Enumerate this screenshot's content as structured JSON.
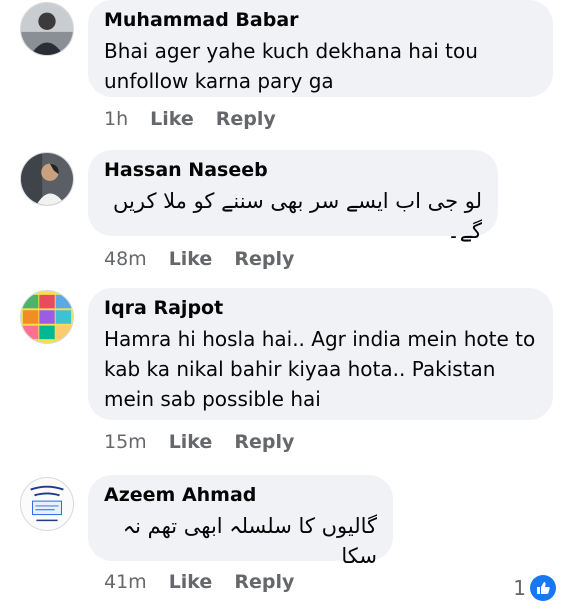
{
  "comments": [
    {
      "author": "Muhammad Babar",
      "text": "Bhai ager yahe kuch dekhana hai tou unfollow karna pary ga",
      "time": "1h",
      "like_label": "Like",
      "reply_label": "Reply"
    },
    {
      "author": "Hassan Naseeb",
      "text": "لو جی اب ایسے سر بھی سننے کو ملا کریں گے۔",
      "time": "48m",
      "like_label": "Like",
      "reply_label": "Reply"
    },
    {
      "author": "Iqra Rajpot",
      "text": "Hamra hi hosla hai.. Agr india mein hote to kab ka nikal bahir kiyaa hota.. Pakistan mein sab possible hai",
      "time": "15m",
      "like_label": "Like",
      "reply_label": "Reply"
    },
    {
      "author": "Azeem Ahmad",
      "text": "گالیوں کا سلسلہ ابھی تھم نہ سکا",
      "time": "41m",
      "like_label": "Like",
      "reply_label": "Reply",
      "reaction_count": "1",
      "reaction_icon": "like-thumb-icon"
    }
  ],
  "colors": {
    "bubble": "#f0f2f5",
    "meta_text": "#65676b",
    "like_badge": "#1877f2"
  }
}
